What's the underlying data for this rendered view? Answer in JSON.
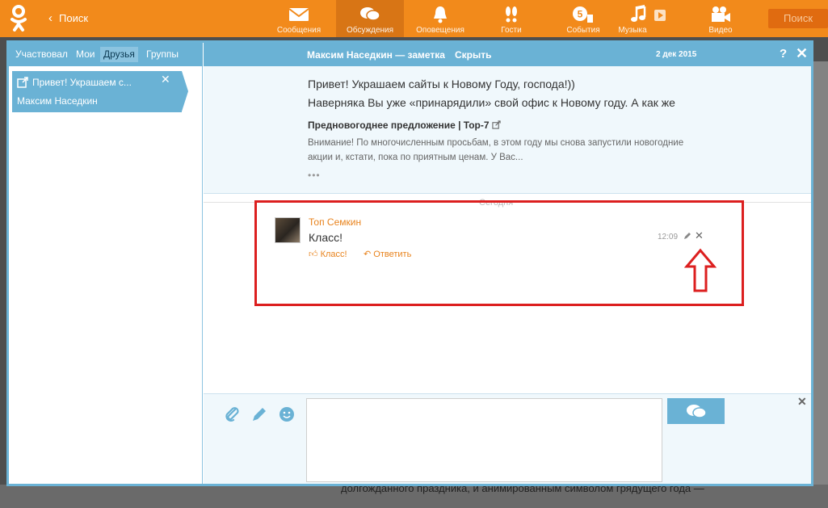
{
  "app": {
    "back_label": "Поиск",
    "search_button": "Поиск",
    "accent_color": "#f28a1b",
    "nav": [
      {
        "label": "Сообщения",
        "icon": "envelope-icon"
      },
      {
        "label": "Обсуждения",
        "icon": "chat-bubbles-icon",
        "active": true
      },
      {
        "label": "Оповещения",
        "icon": "bell-icon"
      },
      {
        "label": "Гости",
        "icon": "footprints-icon"
      },
      {
        "label": "События",
        "icon": "events-icon",
        "badge": "5"
      },
      {
        "label": "Музыка",
        "icon": "music-note-icon"
      },
      {
        "label": "Видео",
        "icon": "video-camera-icon"
      }
    ]
  },
  "discussions": {
    "tabs": [
      {
        "label": "Участвовал"
      },
      {
        "label": "Мои"
      },
      {
        "label": "Друзья",
        "active": true
      },
      {
        "label": "Группы"
      }
    ],
    "conversation": {
      "title": "Привет! Украшаем с...",
      "author": "Максим Наседкин"
    }
  },
  "thread": {
    "title": "Максим Наседкин — заметка",
    "hide_label": "Скрыть",
    "date": "2 дек 2015",
    "help_label": "?",
    "note": {
      "line1": "Привет! Украшаем сайты к Новому Году, господа!))",
      "line2": "Наверняка Вы уже «принарядили» свой офис к Новому году. А как же",
      "link_title": "Предновогоднее предложение | Top-7",
      "desc1": "Внимание! По многочисленным просьбам, в этом году мы снова запустили новогодние",
      "desc2": "акции и, кстати, пока по приятным ценам. У Вас...",
      "more": "•••"
    },
    "separator": "Сегодня",
    "comment": {
      "author": "Топ Семкин",
      "text": "Класс!",
      "time": "12:09",
      "like_label": "Класс!",
      "reply_label": "Ответить"
    }
  },
  "backdrop": {
    "text": "долгожданного праздника, и анимированным символом грядущего года —"
  }
}
